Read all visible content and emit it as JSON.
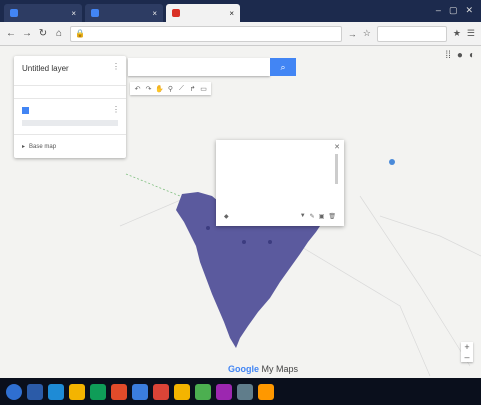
{
  "browser": {
    "tabs": [
      {
        "label": ""
      },
      {
        "label": ""
      },
      {
        "label": "",
        "active": true
      }
    ],
    "url": "",
    "search_placeholder": ""
  },
  "panel": {
    "title": "Untitled layer",
    "subtitle": "",
    "description": "",
    "actions": [
      "",
      "",
      ""
    ],
    "layer": {
      "name": "",
      "link": "",
      "item": ""
    },
    "basemap_label": "Base map"
  },
  "popup": {
    "title": "",
    "code": "",
    "coords": ""
  },
  "map": {
    "place_label": "",
    "logo": "Google",
    "logo_suffix": "My Maps",
    "footer": "",
    "polygon_color": "#5b5a9e",
    "accent": "#4285f4"
  },
  "taskbar": {
    "icons": [
      "#2b5ba8",
      "#1e8bd6",
      "#f4b400",
      "#0f9d58",
      "#e14b2a",
      "#3b7ddd",
      "#db4437",
      "#f4b400",
      "#4caf50",
      "#9c27b0",
      "#607d8b",
      "#ff9800"
    ],
    "time": "",
    "date": ""
  }
}
